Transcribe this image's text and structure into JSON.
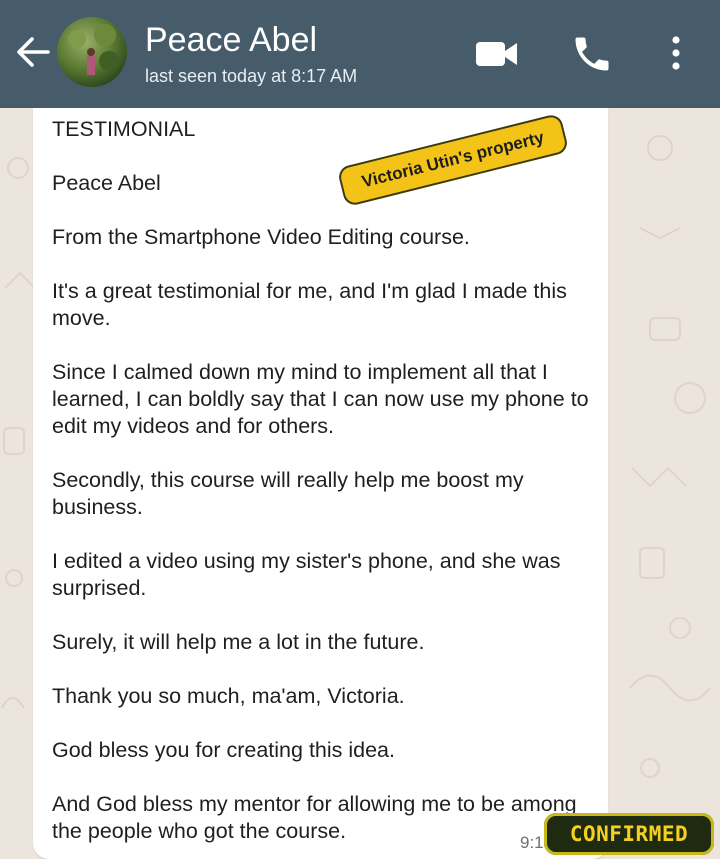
{
  "header": {
    "contact_name": "Peace Abel",
    "status": "last seen today at 8:17 AM",
    "background": "#465c6b",
    "icons": [
      "back-arrow-icon",
      "avatar",
      "video-call-icon",
      "voice-call-icon",
      "more-options-icon"
    ]
  },
  "message": {
    "text": "TESTIMONIAL\n\nPeace Abel\n\nFrom the Smartphone Video Editing course.\n\nIt's a great testimonial for me, and I'm glad I made this move.\n\nSince I calmed down my mind to implement all that I learned, I can boldly say that I can now use my phone to edit my videos and for others.\n\nSecondly, this course will really help me boost my business.\n\nI edited a video using my sister's phone, and she was surprised.\n\nSurely, it will help me a lot in the future.\n\nThank you so much, ma'am, Victoria.\n\nGod bless you for creating this idea.\n\nAnd God bless my mentor for allowing me to be among the people who got the course.",
    "time": "9:1"
  },
  "overlays": {
    "watermark": "Victoria Utin's property",
    "stamp": "CONFIRMED"
  },
  "colors": {
    "chat_background": "#ece5dd",
    "bubble": "#ffffff",
    "watermark": "#f3c317",
    "stamp_text": "#f4d020"
  }
}
